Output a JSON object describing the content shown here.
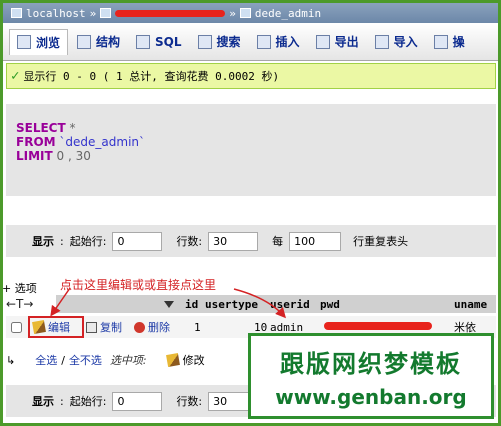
{
  "breadcrumb": {
    "server": "localhost",
    "table": "dede_admin"
  },
  "tabs": [
    {
      "label": "浏览",
      "icon": "browse-icon"
    },
    {
      "label": "结构",
      "icon": "structure-icon"
    },
    {
      "label": "SQL",
      "icon": "sql-icon"
    },
    {
      "label": "搜索",
      "icon": "search-icon"
    },
    {
      "label": "插入",
      "icon": "insert-icon"
    },
    {
      "label": "导出",
      "icon": "export-icon"
    },
    {
      "label": "导入",
      "icon": "import-icon"
    },
    {
      "label": "操",
      "icon": "operations-icon"
    }
  ],
  "message": "显示行 0 - 0 ( 1 总计, 查询花费 0.0002 秒)",
  "sql": {
    "select": "SELECT",
    "star": "*",
    "from": "FROM",
    "table": "`dede_admin`",
    "limit": "LIMIT",
    "limit_args": "0 , 30"
  },
  "nav": {
    "show_label": "显示",
    "start_label": "起始行:",
    "start_value": "0",
    "rows_label": "行数:",
    "rows_value": "30",
    "every_label": "每",
    "every_value": "100",
    "repeat_label": "行重复表头"
  },
  "options_label": "+ 选项",
  "columns": [
    "id",
    "usertype",
    "userid",
    "pwd",
    "uname"
  ],
  "row": {
    "id": "1",
    "usertype": "10",
    "userid": "admin",
    "uname": "米依"
  },
  "actions": {
    "edit": "编辑",
    "copy": "复制",
    "delete": "删除",
    "modify": "修改"
  },
  "select_all": "全选",
  "select_none": "全不选",
  "with_selected": "选中项:",
  "annotation": "点击这里编辑或或直接点这里",
  "watermark": {
    "line1": "跟版网织梦模板",
    "line2": "www.genban.org"
  }
}
